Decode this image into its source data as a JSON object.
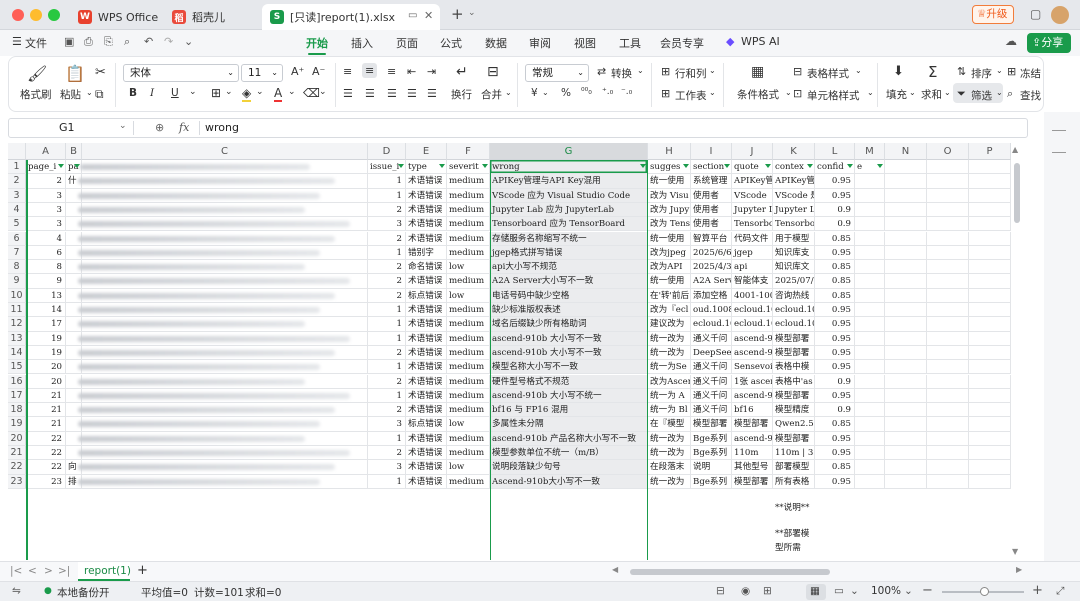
{
  "tabs": [
    {
      "label": "WPS Office",
      "icon": "wps-icon"
    },
    {
      "label": "稻壳儿",
      "icon": "docer-icon"
    },
    {
      "label": "[只读]report(1).xlsx",
      "icon": "spreadsheet-icon",
      "active": true
    }
  ],
  "titlebar": {
    "upgrade": "升级",
    "new_tab": "+"
  },
  "menu": {
    "file": "文件",
    "items": [
      "开始",
      "插入",
      "页面",
      "公式",
      "数据",
      "审阅",
      "视图",
      "工具",
      "会员专享"
    ],
    "active": "开始",
    "wps_ai": "WPS AI",
    "share": "分享"
  },
  "ribbon": {
    "format_painter": "格式刷",
    "paste": "粘贴",
    "font_name": "宋体",
    "font_size": "11",
    "wrap": "换行",
    "merge": "合并",
    "number_format": "常规",
    "convert": "转换",
    "rows_cols": "行和列",
    "worksheet": "工作表",
    "cond_format": "条件格式",
    "table_style": "表格样式",
    "cell_style": "单元格样式",
    "fill": "填充",
    "sum": "求和",
    "sort": "排序",
    "filter": "筛选",
    "freeze": "冻结",
    "find": "查找",
    "bold": "B",
    "italic": "I",
    "underline": "U",
    "currency": "¥",
    "percent": "%"
  },
  "formula_bar": {
    "cell_ref": "G1",
    "fx": "fx",
    "value": "wrong"
  },
  "columns": [
    {
      "letter": "A",
      "header": "page_i"
    },
    {
      "letter": "B",
      "header": "pa"
    },
    {
      "letter": "C",
      "header": ""
    },
    {
      "letter": "D",
      "header": "issue_i"
    },
    {
      "letter": "E",
      "header": "type"
    },
    {
      "letter": "F",
      "header": "severit"
    },
    {
      "letter": "G",
      "header": "wrong"
    },
    {
      "letter": "H",
      "header": "sugges"
    },
    {
      "letter": "I",
      "header": "section"
    },
    {
      "letter": "J",
      "header": "quote"
    },
    {
      "letter": "K",
      "header": "contex"
    },
    {
      "letter": "L",
      "header": "confid"
    },
    {
      "letter": "M",
      "header": "e"
    },
    {
      "letter": "N",
      "header": ""
    },
    {
      "letter": "O",
      "header": ""
    },
    {
      "letter": "P",
      "header": ""
    }
  ],
  "rows": [
    {
      "a": "2",
      "b": "什",
      "d": "1",
      "e": "术语错误",
      "f": "medium",
      "g": "APIKey管理与API Key混用",
      "h": "统一使用",
      "i": "系统管理",
      "j": "APIKey管",
      "k": "APIKey管",
      "l": "0.95"
    },
    {
      "a": "3",
      "b": "",
      "d": "1",
      "e": "术语错误",
      "f": "medium",
      "g": "VScode 应为 Visual Studio Code",
      "h": "改为 Visu",
      "i": "使用者",
      "j": "VScode",
      "k": "VScode 是",
      "l": "0.95"
    },
    {
      "a": "3",
      "b": "",
      "d": "2",
      "e": "术语错误",
      "f": "medium",
      "g": "Jupyter Lab 应为 JupyterLab",
      "h": "改为 Jupy",
      "i": "使用者",
      "j": "Jupyter La",
      "k": "Jupyter La",
      "l": "0.9"
    },
    {
      "a": "3",
      "b": "",
      "d": "3",
      "e": "术语错误",
      "f": "medium",
      "g": "Tensorboard 应为 TensorBoard",
      "h": "改为 Tens",
      "i": "使用者",
      "j": "Tensorboa",
      "k": "Tensorboa",
      "l": "0.9"
    },
    {
      "a": "4",
      "b": "",
      "d": "2",
      "e": "术语错误",
      "f": "medium",
      "g": "存储服务名称缩写不统一",
      "h": "统一使用",
      "i": "智算平台",
      "j": "代码文件",
      "k": "用于模型",
      "l": "0.85"
    },
    {
      "a": "6",
      "b": "",
      "d": "1",
      "e": "错别字",
      "f": "medium",
      "g": "jgep格式拼写错误",
      "h": "改为jpeg",
      "i": "2025/6/6",
      "j": "jgep",
      "k": "知识库支",
      "l": "0.95"
    },
    {
      "a": "8",
      "b": "",
      "d": "2",
      "e": "命名错误",
      "f": "low",
      "g": "api大小写不规范",
      "h": "改为API",
      "i": "2025/4/3",
      "j": "api",
      "k": "知识库文",
      "l": "0.85"
    },
    {
      "a": "9",
      "b": "",
      "d": "2",
      "e": "术语错误",
      "f": "medium",
      "g": "A2A Server大小写不一致",
      "h": "统一使用",
      "i": "A2A Server",
      "j": "智能体支",
      "k": "2025/07/1",
      "l": "0.85"
    },
    {
      "a": "13",
      "b": "",
      "d": "2",
      "e": "标点错误",
      "f": "low",
      "g": "电话号码中缺少空格",
      "h": "在'转'前后",
      "i": "添加空格",
      "j": "4001-1008",
      "k": "咨询热线",
      "l": "0.85"
    },
    {
      "a": "14",
      "b": "",
      "d": "1",
      "e": "术语错误",
      "f": "medium",
      "g": "缺少标准版权表述",
      "h": "改为『ecl",
      "i": "oud.10086.c",
      "j": "ecloud.10",
      "k": "ecloud.10",
      "l": "0.95"
    },
    {
      "a": "17",
      "b": "",
      "d": "1",
      "e": "术语错误",
      "f": "medium",
      "g": "域名后缀缺少所有格助词",
      "h": "建议改为",
      "i": "ecloud.100",
      "j": "ecloud.10",
      "k": "ecloud.10",
      "l": "0.95"
    },
    {
      "a": "19",
      "b": "",
      "d": "1",
      "e": "术语错误",
      "f": "medium",
      "g": "ascend-910b 大小写不一致",
      "h": "统一改为",
      "i": "通义千问",
      "j": "ascend-91",
      "k": "模型部署",
      "l": "0.95"
    },
    {
      "a": "19",
      "b": "",
      "d": "2",
      "e": "术语错误",
      "f": "medium",
      "g": "ascend-910b 大小写不一致",
      "h": "统一改为",
      "i": "DeepSeek",
      "j": "ascend-91",
      "k": "模型部署",
      "l": "0.95"
    },
    {
      "a": "20",
      "b": "",
      "d": "1",
      "e": "术语错误",
      "f": "medium",
      "g": "模型名称大小写不一致",
      "h": "统一为Se",
      "i": "通义千问",
      "j": "Sensevoic",
      "k": "表格中模",
      "l": "0.95"
    },
    {
      "a": "20",
      "b": "",
      "d": "2",
      "e": "术语错误",
      "f": "medium",
      "g": "硬件型号格式不规范",
      "h": "改为Ascen",
      "i": "通义千问",
      "j": "1张 ascen",
      "k": "表格中'as",
      "l": "0.9"
    },
    {
      "a": "21",
      "b": "",
      "d": "1",
      "e": "术语错误",
      "f": "medium",
      "g": "ascend-910b 大小写不统一",
      "h": "统一为 A",
      "i": "通义千问",
      "j": "ascend-91",
      "k": "模型部署",
      "l": "0.95"
    },
    {
      "a": "21",
      "b": "",
      "d": "2",
      "e": "术语错误",
      "f": "medium",
      "g": "bf16 与 FP16 混用",
      "h": "统一为 Bl",
      "i": "通义千问",
      "j": "bf16",
      "k": "模型精度",
      "l": "0.9"
    },
    {
      "a": "21",
      "b": "",
      "d": "3",
      "e": "标点错误",
      "f": "low",
      "g": "多属性未分隔",
      "h": "在『模型",
      "i": "模型部署",
      "j": "模型部署",
      "k": "Qwen2.5-V",
      "l": "0.85"
    },
    {
      "a": "22",
      "b": "",
      "d": "1",
      "e": "术语错误",
      "f": "medium",
      "g": "ascend-910b 产品名称大小写不一致",
      "h": "统一改为",
      "i": "Bge系列",
      "j": "ascend-91",
      "k": "模型部署",
      "l": "0.95"
    },
    {
      "a": "22",
      "b": "",
      "d": "2",
      "e": "术语错误",
      "f": "medium",
      "g": "模型参数单位不统一（m/B）",
      "h": "统一改为",
      "i": "Bge系列",
      "j": "110m",
      "k": "110m | 33",
      "l": "0.95"
    },
    {
      "a": "22",
      "b": "向",
      "d": "3",
      "e": "术语错误",
      "f": "low",
      "g": "说明段落缺少句号",
      "h": "在段落末",
      "i": "说明",
      "j": "其他型号",
      "k": "部署模型",
      "l": "0.85"
    },
    {
      "a": "23",
      "b": "排",
      "d": "1",
      "e": "术语错误",
      "f": "medium",
      "g": "Ascend-910b大小写不一致",
      "h": "统一改为",
      "i": "Bge系列",
      "j": "模型部署",
      "k": "所有表格",
      "l": "0.95"
    }
  ],
  "overflow_text": [
    "**说明**",
    "**部署模",
    "型所需"
  ],
  "sheet": {
    "name": "report(1)",
    "add": "+"
  },
  "status": {
    "backup": "本地备份开",
    "average": "平均值=0",
    "count": "计数=101",
    "sum": "求和=0",
    "zoom": "100%"
  }
}
